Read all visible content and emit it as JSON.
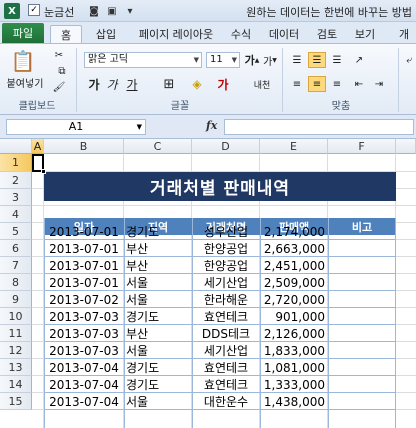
{
  "window": {
    "title": "원하는 데이터는 한번에 바꾸는 방법",
    "app_icon": "X",
    "qat_gridlines_label": "눈금선",
    "qat_gridlines_checked": true
  },
  "tabs": [
    {
      "label": "파일"
    },
    {
      "label": "홈"
    },
    {
      "label": "삽입"
    },
    {
      "label": "페이지 레이아웃"
    },
    {
      "label": "수식"
    },
    {
      "label": "데이터"
    },
    {
      "label": "검토"
    },
    {
      "label": "보기"
    },
    {
      "label": "개"
    }
  ],
  "ribbon": {
    "paste_label": "붙여넣기",
    "clipboard_label": "클립보드",
    "font_group_label": "글꼴",
    "align_group_label": "맞춤",
    "font_name": "맑은 고딕",
    "font_size": "11",
    "bold": "가",
    "italic": "가",
    "underline": "가",
    "grow_font": "가",
    "shrink_font": "가",
    "phonetic": "내천"
  },
  "formula_bar": {
    "name_box": "A1",
    "fx": "fx",
    "formula": ""
  },
  "sheet": {
    "columns": [
      "A",
      "B",
      "C",
      "D",
      "E",
      "F"
    ],
    "rows": [
      "1",
      "2",
      "3",
      "4",
      "5",
      "6",
      "7",
      "8",
      "9",
      "10",
      "11",
      "12",
      "13",
      "14",
      "15"
    ],
    "title": "거래처별 판매내역",
    "headers": [
      "일자",
      "지역",
      "거래처명",
      "판매액",
      "비고"
    ],
    "data": [
      [
        "2013-07-01",
        "경기도",
        "성우산업",
        "2,174,000",
        ""
      ],
      [
        "2013-07-01",
        "부산",
        "한양공업",
        "2,663,000",
        ""
      ],
      [
        "2013-07-01",
        "부산",
        "한양공업",
        "2,451,000",
        ""
      ],
      [
        "2013-07-01",
        "서울",
        "세기산업",
        "2,509,000",
        ""
      ],
      [
        "2013-07-02",
        "서울",
        "한라해운",
        "2,720,000",
        ""
      ],
      [
        "2013-07-03",
        "경기도",
        "효연테크",
        "901,000",
        ""
      ],
      [
        "2013-07-03",
        "부산",
        "DDS테크",
        "2,126,000",
        ""
      ],
      [
        "2013-07-03",
        "서울",
        "세기산업",
        "1,833,000",
        ""
      ],
      [
        "2013-07-04",
        "경기도",
        "효연테크",
        "1,081,000",
        ""
      ],
      [
        "2013-07-04",
        "경기도",
        "효연테크",
        "1,333,000",
        ""
      ],
      [
        "2013-07-04",
        "서울",
        "대한운수",
        "1,438,000",
        ""
      ]
    ]
  },
  "colors": {
    "title_band": "#1f3864",
    "header_fill": "#4f81bd",
    "file_tab": "#1e7145"
  }
}
